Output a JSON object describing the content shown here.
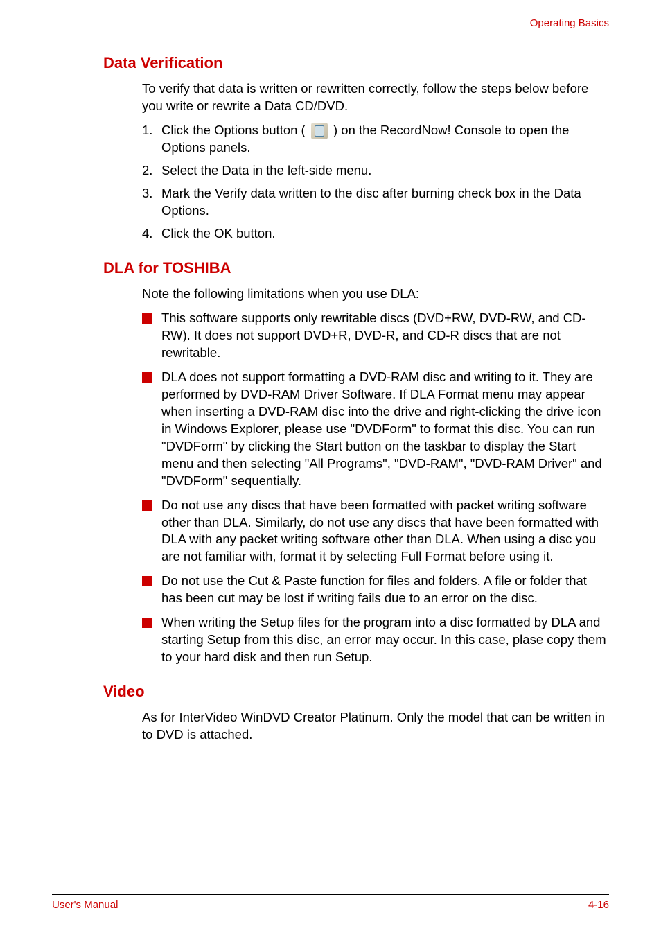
{
  "header": {
    "right": "Operating Basics"
  },
  "section1": {
    "heading": "Data Verification",
    "intro": "To verify that data is written or rewritten correctly, follow the steps below before  you write or rewrite a Data CD/DVD.",
    "steps": {
      "n1": "1.",
      "t1a": "Click the Options button ( ",
      "t1b": " ) on the RecordNow! Console to open the Options panels.",
      "n2": "2.",
      "t2": "Select the Data in the left-side menu.",
      "n3": "3.",
      "t3": "Mark the Verify data written to the disc after burning check box in the Data  Options.",
      "n4": "4.",
      "t4": "Click the OK button."
    }
  },
  "section2": {
    "heading": "DLA for TOSHIBA",
    "intro": "Note the following limitations when you use DLA:",
    "bullets": {
      "b1": "This software supports only rewritable discs (DVD+RW, DVD-RW, and CD-RW). It does not support DVD+R, DVD-R, and CD-R discs that are not rewritable.",
      "b2": "DLA does not support formatting a DVD-RAM disc and writing to it. They are performed by DVD-RAM Driver Software.  If DLA Format menu may appear when inserting a DVD-RAM disc into the drive and right-clicking the drive icon in Windows Explorer, please use \"DVDForm\" to format this disc. You can run \"DVDForm\" by clicking the Start button on the taskbar to display the Start menu and then selecting \"All Programs\", \"DVD-RAM\", \"DVD-RAM Driver\" and \"DVDForm\" sequentially.",
      "b3": "Do not use any discs that have been formatted with packet writing software other than DLA. Similarly, do not use any discs that have been formatted with DLA with any packet writing software other than DLA. When using a disc you are not familiar with, format it by selecting Full Format before using it.",
      "b4": "Do not use the Cut & Paste function for files and folders. A file or folder that has been cut may be lost if writing fails due to an error on the disc.",
      "b5": "When writing the Setup files for the program into a disc formatted by DLA and starting Setup from this disc, an error may occur. In this case, plase copy them to your hard disk and then run Setup."
    }
  },
  "section3": {
    "heading": "Video",
    "body": "As for InterVideo WinDVD Creator Platinum. Only the model that can be written in to DVD is attached."
  },
  "footer": {
    "left": "User's Manual",
    "right": "4-16"
  }
}
